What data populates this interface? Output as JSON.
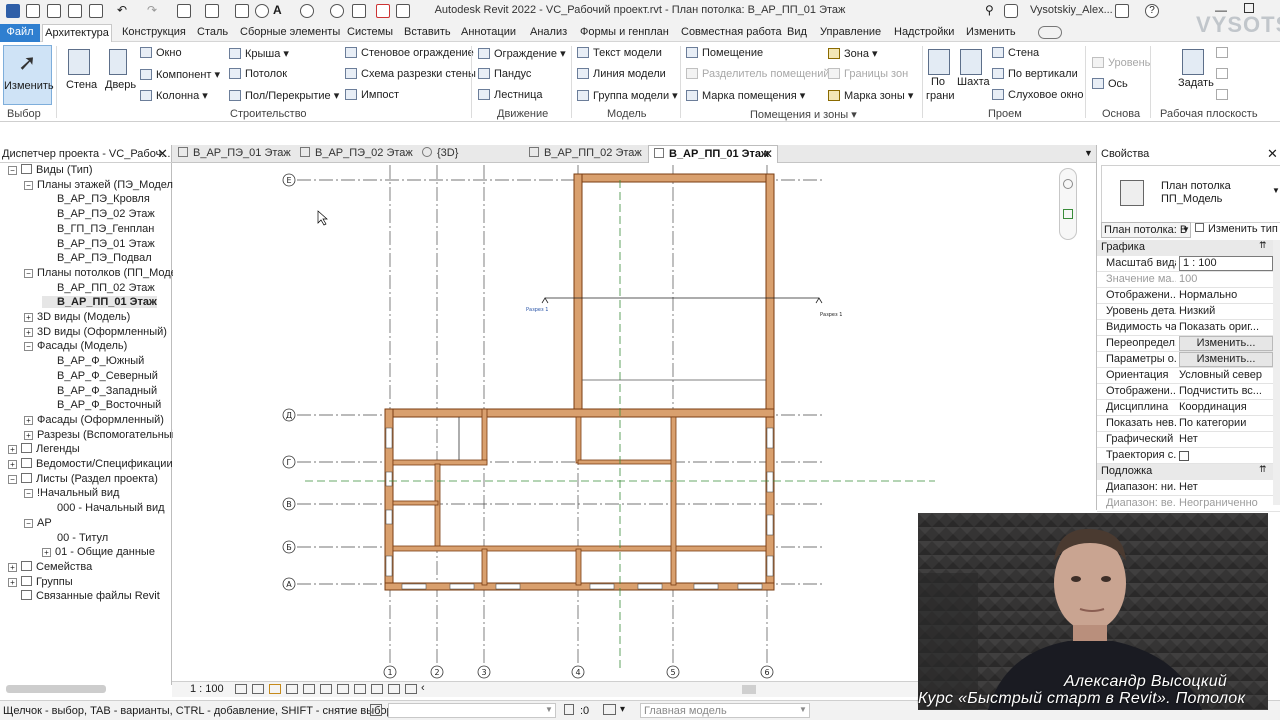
{
  "window": {
    "title": "Autodesk Revit 2022 - VC_Рабочий проект.rvt - План потолка: В_АР_ПП_01 Этаж",
    "user": "Vysotskiy_Alex..."
  },
  "menu_tabs": [
    "Файл",
    "Архитектура",
    "Конструкция",
    "Сталь",
    "Сборные элементы",
    "Системы",
    "Вставить",
    "Аннотации",
    "Анализ",
    "Формы и генплан",
    "Совместная работа",
    "Вид",
    "Управление",
    "Надстройки",
    "Изменить"
  ],
  "ribbon": {
    "modify_label": "Изменить",
    "wall_label": "Стена",
    "door_label": "Дверь",
    "window_label": "Окно",
    "component_label": "Компонент",
    "column_label": "Колонна",
    "roof_label": "Крыша",
    "ceiling_label": "Потолок",
    "floor_label": "Пол/Перекрытие",
    "curtain_wall_label": "Стеновое ограждение",
    "curtain_system_label": "Схема разрезки стены",
    "mullion_label": "Импост",
    "railing_label": "Ограждение",
    "ramp_label": "Пандус",
    "stair_label": "Лестница",
    "model_text_label": "Текст модели",
    "model_line_label": "Линия модели",
    "model_group_label": "Группа модели",
    "room_label": "Помещение",
    "room_separator_label": "Разделитель помещений",
    "room_tag_label": "Марка помещения",
    "area_label": "Зона",
    "area_boundary_label": "Границы зон",
    "area_tag_label": "Марка зоны",
    "by_face_label_1": "По",
    "by_face_label_2": "грани",
    "shaft_label": "Шахта",
    "wall_opening_label": "Стена",
    "vertical_label": "По вертикали",
    "dormer_label": "Слуховое окно",
    "level_label": "Уровень",
    "grid_label": "Ось",
    "set_label": "Задать",
    "groups": {
      "select": "Выбор",
      "build": "Строительство",
      "circulation": "Движение",
      "model": "Модель",
      "room_area": "Помещения и зоны",
      "opening": "Проем",
      "datum": "Основа",
      "work_plane": "Рабочая плоскость"
    }
  },
  "browser": {
    "title": "Диспетчер проекта - VC_Рабоч...",
    "items": [
      {
        "label": "Виды (Тип)",
        "level": 0,
        "exp": "−"
      },
      {
        "label": "Планы этажей (ПЭ_Модель",
        "level": 1,
        "exp": "−"
      },
      {
        "label": "В_АР_ПЭ_Кровля",
        "level": 2,
        "exp": ""
      },
      {
        "label": "В_АР_ПЭ_02 Этаж",
        "level": 2,
        "exp": ""
      },
      {
        "label": "В_ГП_ПЭ_Генплан",
        "level": 2,
        "exp": ""
      },
      {
        "label": "В_АР_ПЭ_01 Этаж",
        "level": 2,
        "exp": ""
      },
      {
        "label": "В_АР_ПЭ_Подвал",
        "level": 2,
        "exp": ""
      },
      {
        "label": "Планы потолков (ПП_Моде.",
        "level": 1,
        "exp": "−"
      },
      {
        "label": "В_АР_ПП_02 Этаж",
        "level": 2,
        "exp": ""
      },
      {
        "label": "В_АР_ПП_01 Этаж",
        "level": 2,
        "exp": "",
        "bold": true
      },
      {
        "label": "3D виды (Модель)",
        "level": 1,
        "exp": "+"
      },
      {
        "label": "3D виды (Оформленный)",
        "level": 1,
        "exp": "+"
      },
      {
        "label": "Фасады (Модель)",
        "level": 1,
        "exp": "−"
      },
      {
        "label": "В_АР_Ф_Южный",
        "level": 2,
        "exp": ""
      },
      {
        "label": "В_АР_Ф_Северный",
        "level": 2,
        "exp": ""
      },
      {
        "label": "В_АР_Ф_Западный",
        "level": 2,
        "exp": ""
      },
      {
        "label": "В_АР_Ф_Восточный",
        "level": 2,
        "exp": ""
      },
      {
        "label": "Фасады (Оформленный)",
        "level": 1,
        "exp": "+"
      },
      {
        "label": "Разрезы (Вспомогательный",
        "level": 1,
        "exp": "+"
      },
      {
        "label": "Легенды",
        "level": 0,
        "exp": "+"
      },
      {
        "label": "Ведомости/Спецификации (Н",
        "level": 0,
        "exp": "+"
      },
      {
        "label": "Листы (Раздел проекта)",
        "level": 0,
        "exp": "−"
      },
      {
        "label": "!Начальный вид",
        "level": 1,
        "exp": "−"
      },
      {
        "label": "000 - Начальный вид",
        "level": 2,
        "exp": ""
      },
      {
        "label": "АР",
        "level": 1,
        "exp": "−"
      },
      {
        "label": "00 - Титул",
        "level": 2,
        "exp": ""
      },
      {
        "label": "01 - Общие данные",
        "level": 2,
        "exp": "+"
      },
      {
        "label": "Семейства",
        "level": 0,
        "exp": "+"
      },
      {
        "label": "Группы",
        "level": 0,
        "exp": "+"
      },
      {
        "label": "Связанные файлы Revit",
        "level": 0,
        "exp": ""
      }
    ]
  },
  "doc_tabs": [
    {
      "label": "В_АР_ПЭ_01 Этаж"
    },
    {
      "label": "В_АР_ПЭ_02 Этаж"
    },
    {
      "label": "{3D}"
    },
    {
      "label": "В_АР_ПП_02 Этаж"
    },
    {
      "label": "В_АР_ПП_01 Этаж",
      "active": true
    }
  ],
  "canvas": {
    "grid_rows": [
      "Е",
      "Д",
      "Г",
      "В",
      "Б",
      "А"
    ],
    "grid_cols": [
      "1",
      "2",
      "3",
      "4",
      "5",
      "6"
    ],
    "section_label": "Разрез 1"
  },
  "properties": {
    "title": "Свойства",
    "type_name_1": "План потолка",
    "type_name_2": "ПП_Модель",
    "selector": "План потолка: В",
    "edit_type": "Изменить тип",
    "section_graphics": "Графика",
    "section_underlay": "Подложка",
    "rows": [
      {
        "key": "Масштаб вида",
        "value": "1 : 100",
        "kind": "box"
      },
      {
        "key": "Значение ма...",
        "value": "100",
        "kind": "dis"
      },
      {
        "key": "Отображени...",
        "value": "Нормально",
        "kind": ""
      },
      {
        "key": "Уровень дета...",
        "value": "Низкий",
        "kind": ""
      },
      {
        "key": "Видимость ча...",
        "value": "Показать ориг...",
        "kind": ""
      },
      {
        "key": "Переопредел...",
        "value": "Изменить...",
        "kind": "btn"
      },
      {
        "key": "Параметры о...",
        "value": "Изменить...",
        "kind": "btn"
      },
      {
        "key": "Ориентация",
        "value": "Условный север",
        "kind": ""
      },
      {
        "key": "Отображени...",
        "value": "Подчистить вс...",
        "kind": ""
      },
      {
        "key": "Дисциплина",
        "value": "Координация",
        "kind": ""
      },
      {
        "key": "Показать нев...",
        "value": "По категории",
        "kind": ""
      },
      {
        "key": "Графический ...",
        "value": "Нет",
        "kind": ""
      },
      {
        "key": "Траектория с...",
        "value": "",
        "kind": "check"
      }
    ],
    "underlay_rows": [
      {
        "key": "Диапазон: ни...",
        "value": "Нет",
        "kind": ""
      },
      {
        "key": "Диапазон: ве...",
        "value": "Неограниченно",
        "kind": "dis"
      }
    ]
  },
  "view_control": {
    "scale": "1 : 100"
  },
  "status": {
    "hint": "Щелчок - выбор, TAB - варианты, CTRL - добавление, SHIFT - снятие выбора.",
    "zero": ":0",
    "model": "Главная модель"
  },
  "webcam": {
    "name": "Александр Высоцкий",
    "course": "Курс «Быстрый старт в Revit». Потолок"
  },
  "watermark": "VYSOTSKIY",
  "colors": {
    "file_tab": "#2f7fd0",
    "wall_fill": "#d9a06e",
    "wall_outline": "#7a3d12",
    "selection": "#cfe3f6"
  }
}
